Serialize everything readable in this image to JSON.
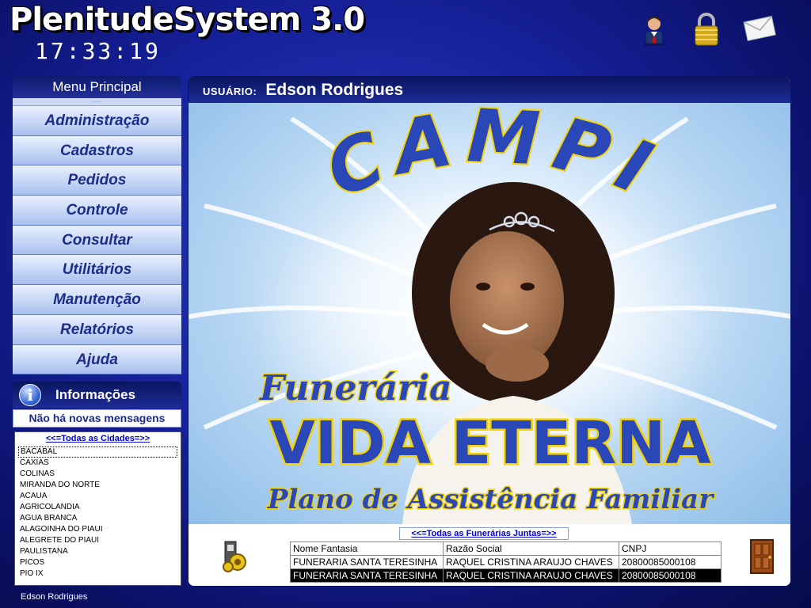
{
  "app": {
    "title": "PlenitudeSystem 3.0",
    "clock": "17:33:19"
  },
  "header_icons": [
    {
      "name": "user-icon"
    },
    {
      "name": "lock-icon"
    },
    {
      "name": "mail-icon"
    }
  ],
  "menu": {
    "title": "Menu Principal",
    "items": [
      "Administração",
      "Cadastros",
      "Pedidos",
      "Controle",
      "Consultar",
      "Utilitários",
      "Manutenção",
      "Relatórios",
      "Ajuda"
    ]
  },
  "info": {
    "title": "Informações",
    "messages": "Não há novas mensagens"
  },
  "cities": {
    "all_link": "<<=Todas as Cidades=>>",
    "items": [
      "BACABAL",
      "CAXIAS",
      "COLINAS",
      "MIRANDA DO NORTE",
      "ACAUA",
      "AGRICOLANDIA",
      "AGUA BRANCA",
      "ALAGOINHA DO PIAUI",
      "ALEGRETE DO PIAUI",
      "PAULISTANA",
      "PICOS",
      "PIO IX"
    ],
    "selected": "BACABAL"
  },
  "user": {
    "label": "USUÁRIO:",
    "name": "Edson Rodrigues"
  },
  "banner": {
    "word_top": "CAMPI",
    "line1": "Funerária",
    "line2": "VIDA ETERNA",
    "line3": "Plano de Assistência Familiar"
  },
  "funerarias": {
    "all_link": "<<=Todas as Funerárias Juntas=>>",
    "columns": [
      "Nome Fantasia",
      "Razão Social",
      "CNPJ"
    ],
    "rows": [
      [
        "FUNERARIA SANTA TERESINHA",
        "RAQUEL CRISTINA ARAUJO CHAVES",
        "20800085000108"
      ],
      [
        "FUNERARIA SANTA TERESINHA",
        "RAQUEL CRISTINA ARAUJO CHAVES",
        "20800085000108"
      ]
    ]
  },
  "footer": {
    "user": "Edson Rodrigues"
  },
  "colors": {
    "accent": "#1b2d8a",
    "background": "#16209a",
    "banner_text": "#2a47b8",
    "banner_outline": "#f4d20a"
  }
}
